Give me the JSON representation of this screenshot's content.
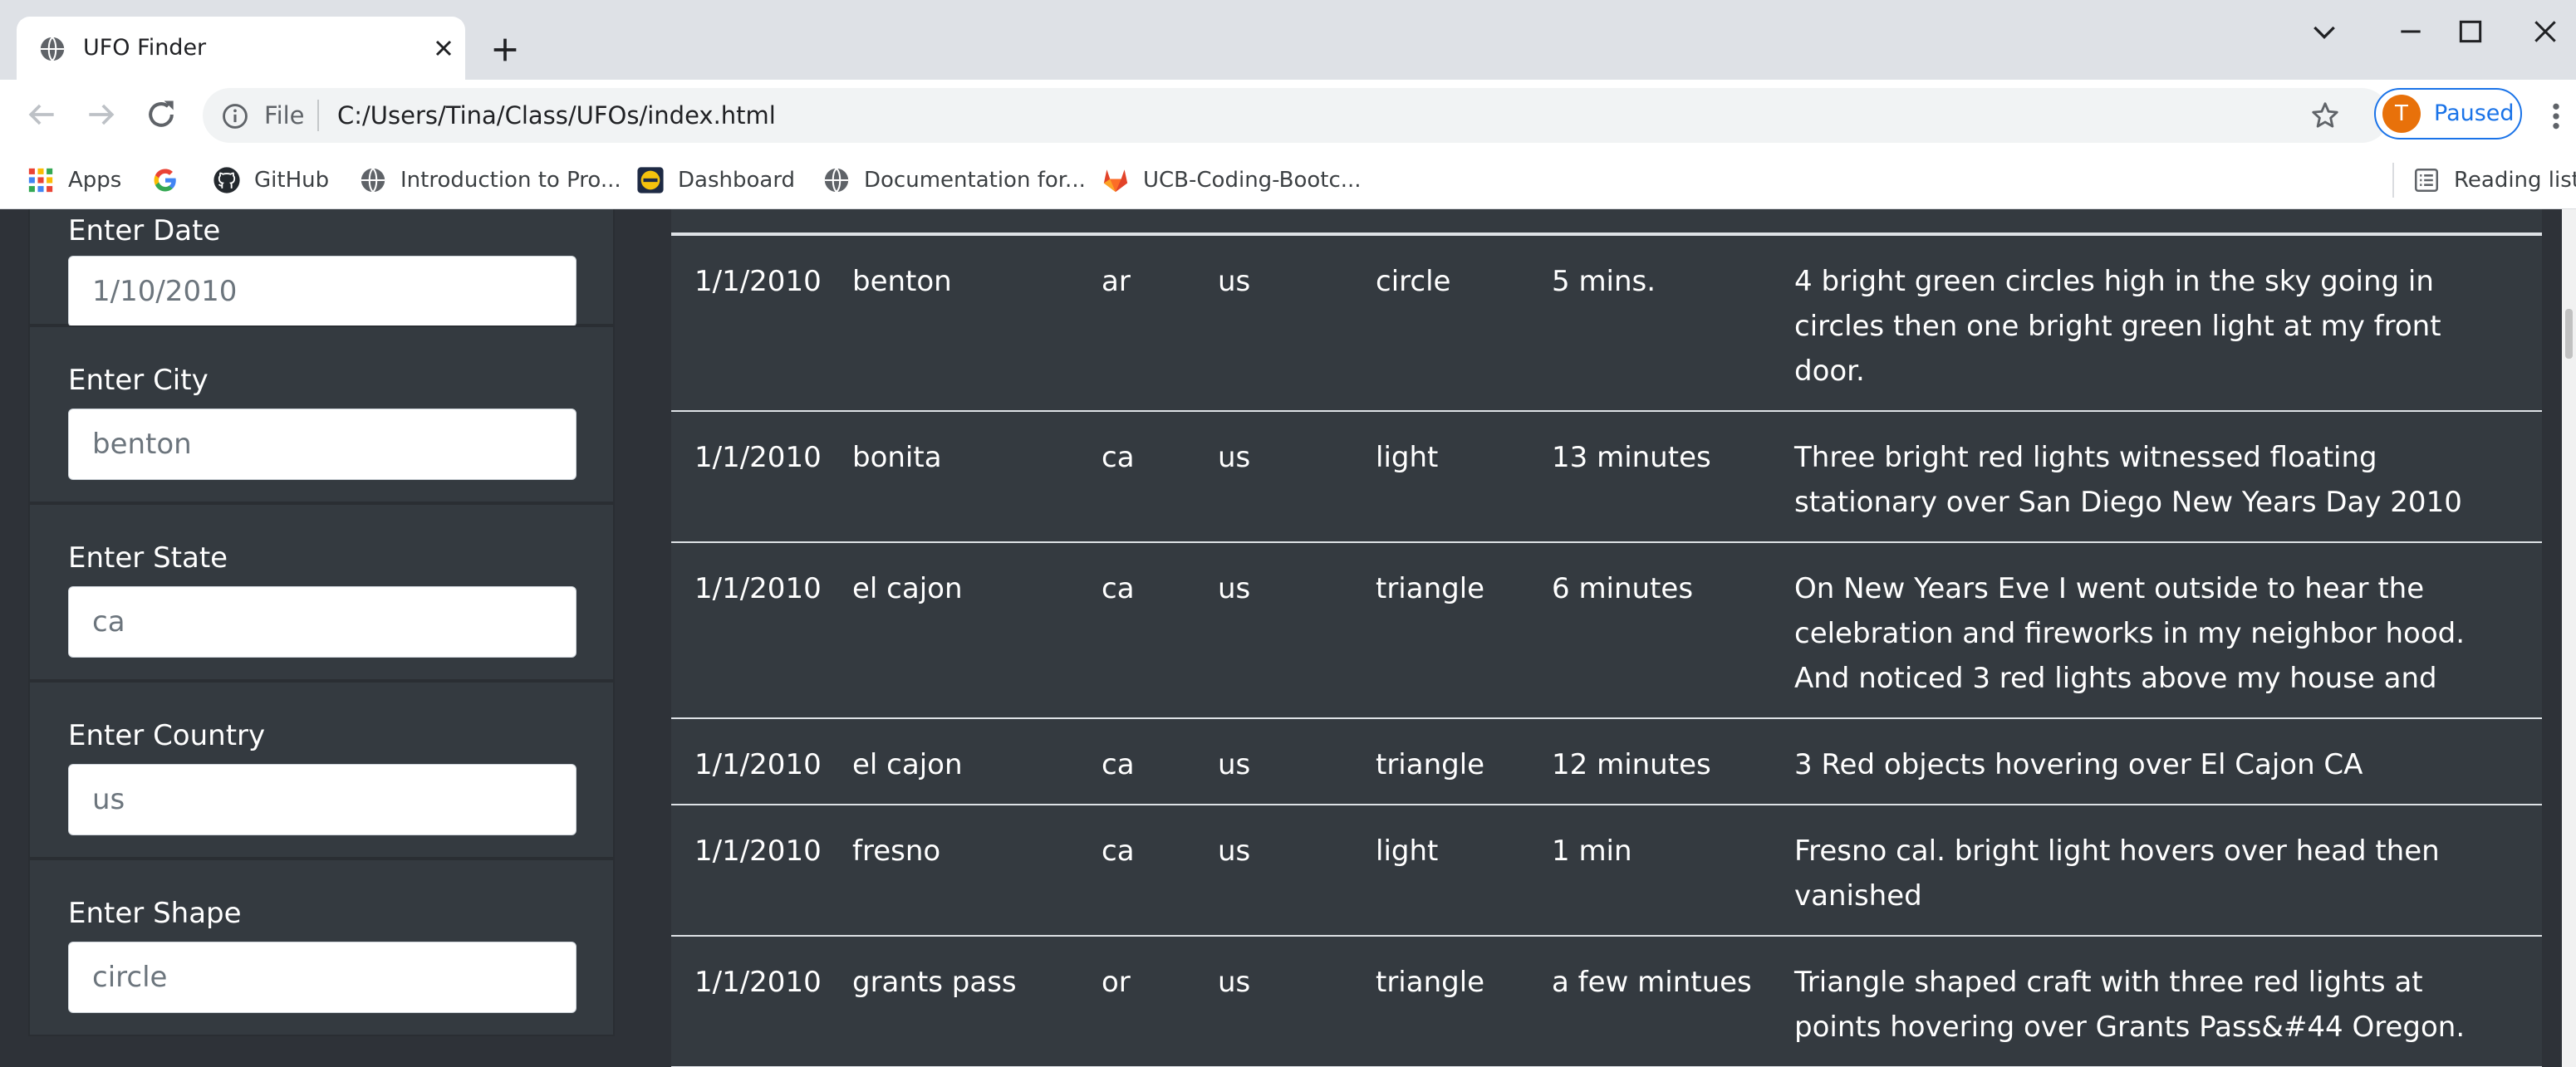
{
  "browser": {
    "tab": {
      "title": "UFO Finder",
      "favicon": "globe-icon"
    },
    "url": {
      "scheme": "File",
      "path": "C:/Users/Tina/Class/UFOs/index.html"
    },
    "profile": {
      "initial": "T",
      "status": "Paused",
      "color": "#e8710a"
    },
    "bookmarks": [
      {
        "label": "Apps",
        "icon": "apps-grid-icon"
      },
      {
        "label": "",
        "icon": "google-icon"
      },
      {
        "label": "GitHub",
        "icon": "github-icon"
      },
      {
        "label": "Introduction to Pro...",
        "icon": "globe-icon"
      },
      {
        "label": "Dashboard",
        "icon": "dashboard-logo-icon"
      },
      {
        "label": "Documentation for...",
        "icon": "globe-icon"
      },
      {
        "label": "UCB-Coding-Bootc...",
        "icon": "gitlab-icon"
      }
    ],
    "reading_list": "Reading list"
  },
  "filters": [
    {
      "label": "Enter Date",
      "placeholder": "1/10/2010"
    },
    {
      "label": "Enter City",
      "placeholder": "benton"
    },
    {
      "label": "Enter State",
      "placeholder": "ca"
    },
    {
      "label": "Enter Country",
      "placeholder": "us"
    },
    {
      "label": "Enter Shape",
      "placeholder": "circle"
    }
  ],
  "rows": [
    {
      "date": "1/1/2010",
      "city": "benton",
      "state": "ar",
      "country": "us",
      "shape": "circle",
      "duration": "5 mins.",
      "comments": "4 bright green circles high in the sky going in circles then one bright green light at my front door."
    },
    {
      "date": "1/1/2010",
      "city": "bonita",
      "state": "ca",
      "country": "us",
      "shape": "light",
      "duration": "13 minutes",
      "comments": "Three bright red lights witnessed floating stationary over San Diego New Years Day 2010"
    },
    {
      "date": "1/1/2010",
      "city": "el cajon",
      "state": "ca",
      "country": "us",
      "shape": "triangle",
      "duration": "6 minutes",
      "comments": "On New Years Eve I went outside to hear the celebration and fireworks in my neighbor hood. And noticed 3 red lights above my house and"
    },
    {
      "date": "1/1/2010",
      "city": "el cajon",
      "state": "ca",
      "country": "us",
      "shape": "triangle",
      "duration": "12 minutes",
      "comments": "3 Red objects hovering over El Cajon CA"
    },
    {
      "date": "1/1/2010",
      "city": "fresno",
      "state": "ca",
      "country": "us",
      "shape": "light",
      "duration": "1 min",
      "comments": "Fresno cal. bright light hovers over head then vanished"
    },
    {
      "date": "1/1/2010",
      "city": "grants pass",
      "state": "or",
      "country": "us",
      "shape": "triangle",
      "duration": "a few mintues",
      "comments": "Triangle shaped craft with three red lights at points hovering over Grants Pass&#44 Oregon."
    }
  ]
}
